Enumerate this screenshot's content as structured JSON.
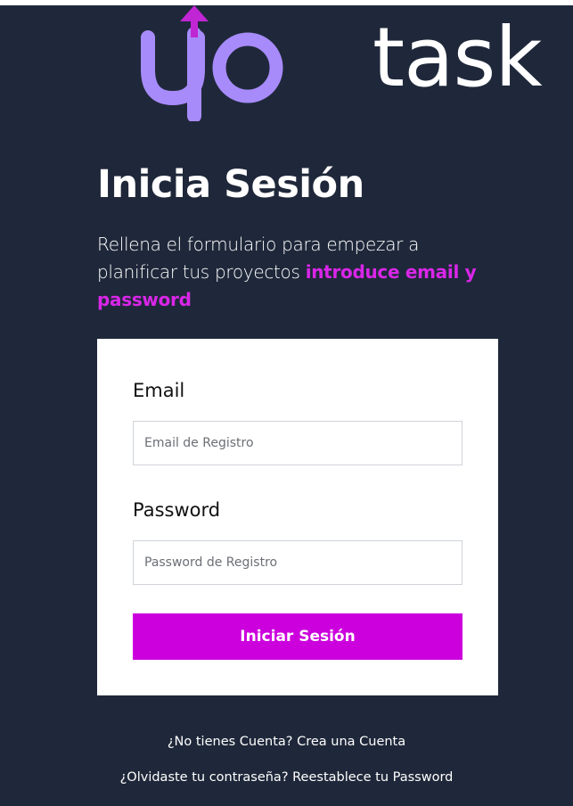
{
  "logo": {
    "part1": "up",
    "part2": "task",
    "colors": {
      "up": "#a78bfa",
      "arrow": "#c026d3",
      "task": "#ffffff"
    }
  },
  "heading": {
    "title": "Inicia Sesión",
    "subtitle_text": "Rellena el formulario para empezar a planificar tus proyectos ",
    "subtitle_accent": "introduce email y password"
  },
  "form": {
    "email_label": "Email",
    "email_placeholder": "Email de Registro",
    "email_value": "",
    "password_label": "Password",
    "password_placeholder": "Password de Registro",
    "password_value": "",
    "submit_label": "Iniciar Sesión"
  },
  "links": {
    "register": "¿No tienes Cuenta? Crea una Cuenta",
    "forgot": "¿Olvidaste tu contraseña? Reestablece tu Password"
  },
  "colors": {
    "background": "#1f283a",
    "accent": "#cc00dd",
    "accent_text": "#d926e8",
    "card": "#ffffff"
  }
}
